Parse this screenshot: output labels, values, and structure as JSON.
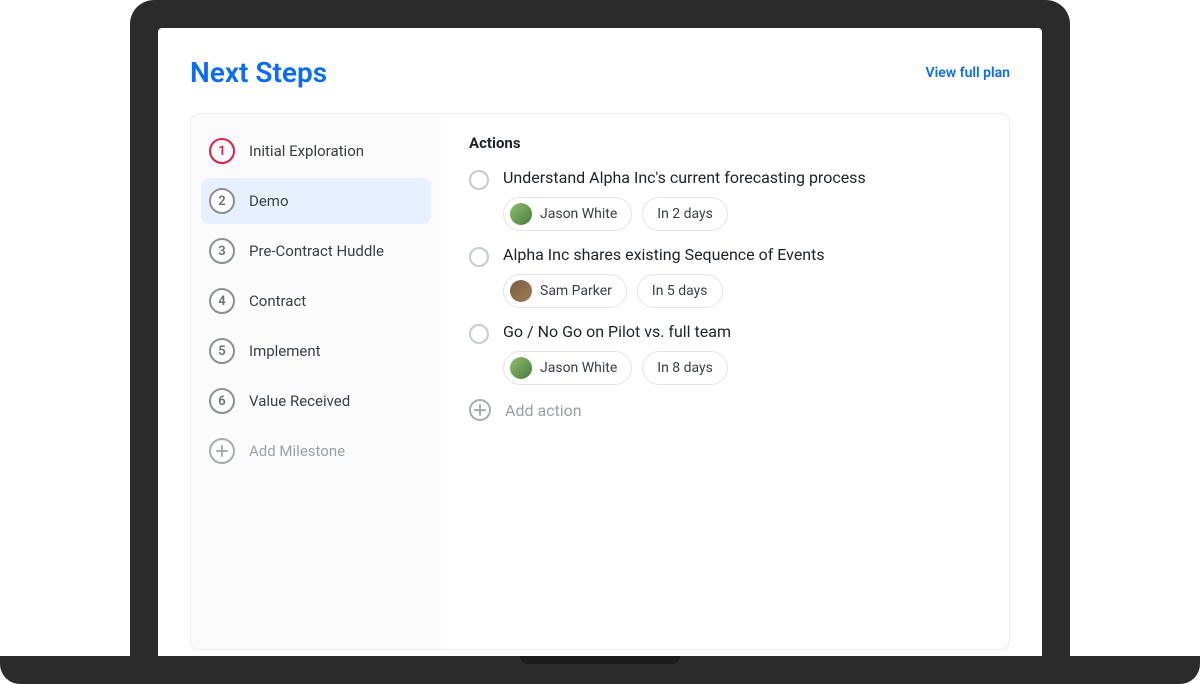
{
  "header": {
    "title": "Next Steps",
    "view_link": "View full plan"
  },
  "sidebar": {
    "items": [
      {
        "num": "1",
        "label": "Initial Exploration",
        "active": true,
        "selected": false
      },
      {
        "num": "2",
        "label": "Demo",
        "active": false,
        "selected": true
      },
      {
        "num": "3",
        "label": "Pre-Contract Huddle",
        "active": false,
        "selected": false
      },
      {
        "num": "4",
        "label": "Contract",
        "active": false,
        "selected": false
      },
      {
        "num": "5",
        "label": "Implement",
        "active": false,
        "selected": false
      },
      {
        "num": "6",
        "label": "Value Received",
        "active": false,
        "selected": false
      }
    ],
    "add_label": "Add Milestone"
  },
  "actions": {
    "heading": "Actions",
    "items": [
      {
        "title": "Understand Alpha Inc's current forecasting process",
        "assignee": "Jason White",
        "avatar_variant": "green",
        "due": "In 2 days"
      },
      {
        "title": "Alpha Inc shares existing Sequence of Events",
        "assignee": "Sam Parker",
        "avatar_variant": "alt",
        "due": "In 5 days"
      },
      {
        "title": "Go / No Go on Pilot vs. full team",
        "assignee": "Jason White",
        "avatar_variant": "green",
        "due": "In 8 days"
      }
    ],
    "add_label": "Add action"
  }
}
